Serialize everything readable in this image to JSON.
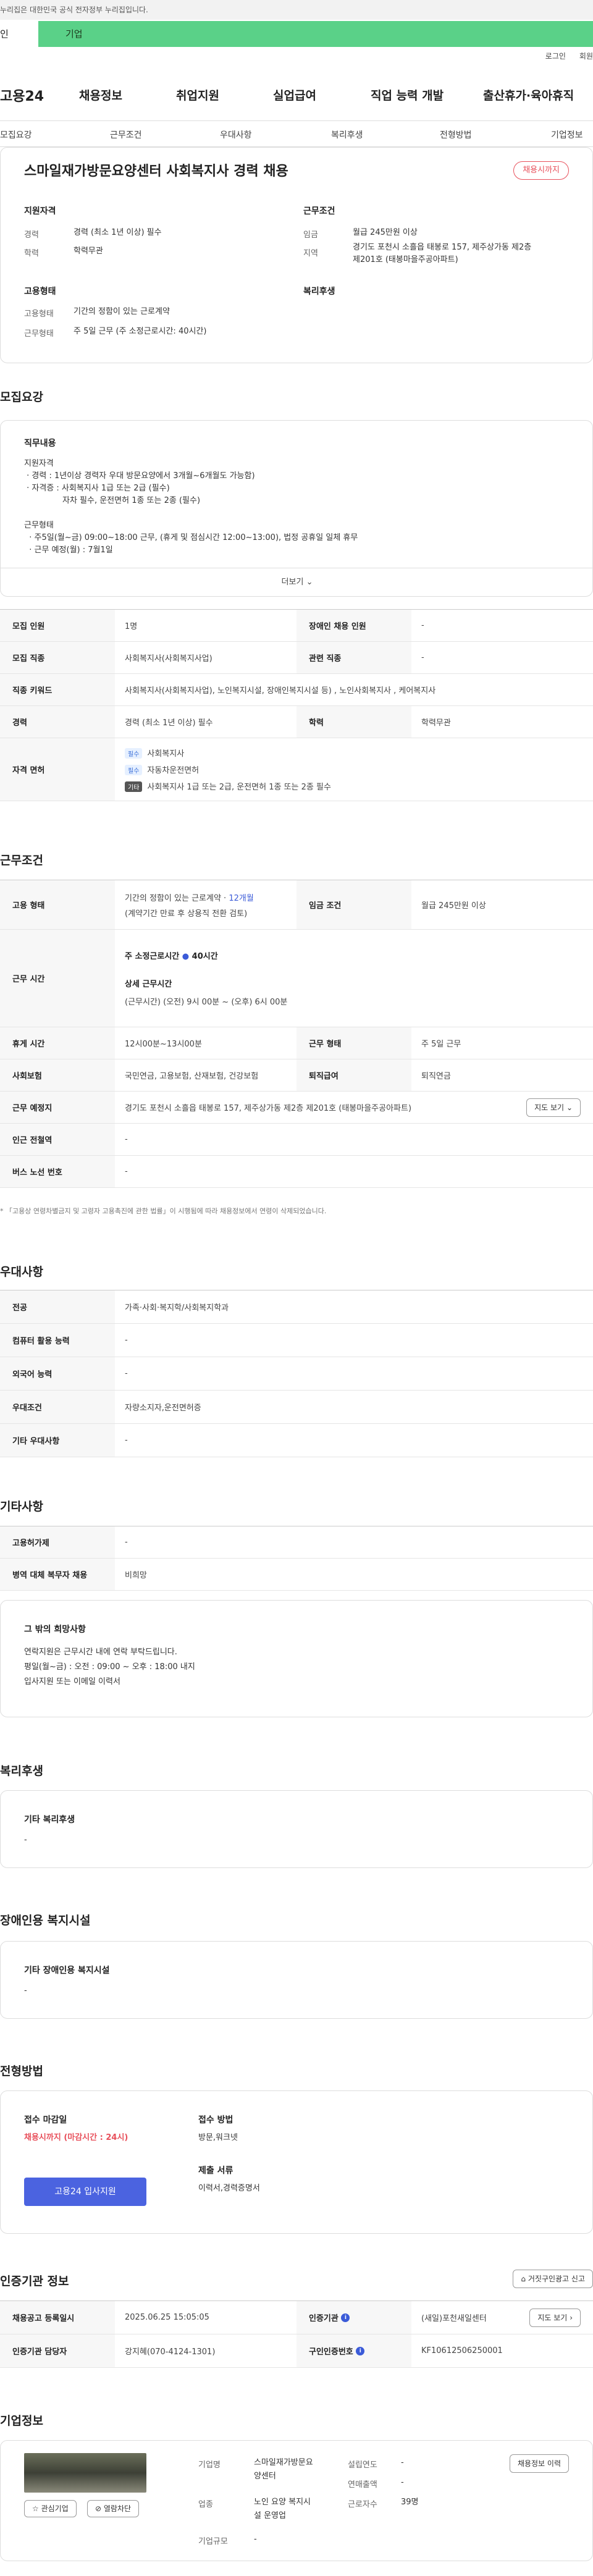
{
  "top_notice": "누리집은 대한민국 공식 전자정부 누리집입니다.",
  "tabs": {
    "person": "인",
    "company": "기업"
  },
  "util": {
    "login": "로그인",
    "join": "회원"
  },
  "logo": "고용24",
  "gnb": [
    "채용정보",
    "취업지원",
    "실업급여",
    "직업 능력 개발",
    "출산휴가·육아휴직"
  ],
  "subnav": [
    "모집요강",
    "근무조건",
    "우대사항",
    "복리후생",
    "전형방법",
    "기업정보"
  ],
  "job": {
    "title": "스마일재가방문요양센터 사회복지사 경력 채용",
    "status_badge": "채용시까지",
    "qual_label": "지원자격",
    "career_k": "경력",
    "career_v": "경력 (최소 1년 이상) 필수",
    "edu_k": "학력",
    "edu_v": "학력무관",
    "emp_label": "고용형태",
    "emptype_k": "고용형태",
    "emptype_v": "기간의 정함이 있는 근로계약",
    "worktype_k": "근무형태",
    "worktype_v": "주 5일 근무 (주 소정근로시간: 40시간)",
    "cond_label": "근무조건",
    "wage_k": "임금",
    "wage_v": "월급 245만원 이상",
    "area_k": "지역",
    "area_v1": "경기도 포천시 소흘읍 태봉로 157, 제주상가동 제2층",
    "area_v2": "제201호 (태봉마을주공아파트)",
    "welfare_label": "복리후생"
  },
  "recruit": {
    "heading": "모집요강",
    "duty_title": "직무내용",
    "duty_text": "지원자격\n · 경력 : 1년이상 경력자 우대 방문요양에서 3개월~6개월도 가능함)\n · 자격증 : 사회복지사 1급 또는 2급 (필수)\n               자차 필수, 운전면허 1종 또는 2종 (필수)\n\n근무형태\n  · 주5일(월~금) 09:00~18:00 근무, (휴게 및 점심시간 12:00~13:00), 법정 공휴일 일체 휴무\n  · 근무 예정(월) : 7월1일",
    "more": "더보기",
    "rows": [
      {
        "k1": "모집 인원",
        "v1": "1명",
        "k2": "장애인 채용 인원",
        "v2": "-"
      },
      {
        "k1": "모집 직종",
        "v1": "사회복지사(사회복지사업)",
        "k2": "관련 직종",
        "v2": "-"
      },
      {
        "k1": "직종 키워드",
        "v1": "사회복지사(사회복지사업), 노인복지시설, 장애인복지시설 등) , 노인사회복지사 , 케어복지사"
      },
      {
        "k1": "경력",
        "v1": "경력 (최소 1년 이상) 필수",
        "k2": "학력",
        "v2": "학력무관"
      }
    ],
    "license_k": "자격 면허",
    "licenses": [
      {
        "chip": "필수",
        "text": "사회복지사"
      },
      {
        "chip": "필수",
        "text": "자동차운전면허"
      },
      {
        "chip": "기타",
        "text": "사회복지사 1급 또는 2급, 운전면허 1종 또는 2종 필수"
      }
    ]
  },
  "work": {
    "heading": "근무조건",
    "emp_k": "고용 형태",
    "emp_v1": "기간의 정함이 있는 근로계약 · ",
    "emp_v1b": "12개월",
    "emp_v2": "(계약기간 만료 후 상용직 전환 검토)",
    "wage_k": "임금 조건",
    "wage_v": "월급 245만원 이상",
    "time_k": "근무 시간",
    "time_v1": "주 소정근로시간",
    "time_v1b": "40시간",
    "time_v2": "상세 근무시간",
    "time_v3": "(근무시간) (오전) 9시 00분 ~ (오후) 6시 00분",
    "break_k": "휴게 시간",
    "break_v": "12시00분~13시00분",
    "form_k": "근무 형태",
    "form_v": "주 5일 근무",
    "ins_k": "사회보험",
    "ins_v": "국민연금, 고용보험, 산재보험, 건강보험",
    "ret_k": "퇴직급여",
    "ret_v": "퇴직연금",
    "place_k": "근무 예정지",
    "place_v": "경기도 포천시 소흘읍 태봉로 157, 제주상가동 제2층 제201호 (태봉마을주공아파트)",
    "map_btn": "지도 보기",
    "subway_k": "인근 전철역",
    "subway_v": "-",
    "bus_k": "버스 노선 번호",
    "bus_v": "-",
    "note": "* 「고용상 연령차별금지 및 고령자 고용촉진에 관한 법률」이 시행됨에 따라 채용정보에서 연령이 삭제되었습니다."
  },
  "pref": {
    "heading": "우대사항",
    "rows": [
      {
        "k": "전공",
        "v": "가족·사회·복지학/사회복지학과"
      },
      {
        "k": "컴퓨터 활용 능력",
        "v": "-"
      },
      {
        "k": "외국어 능력",
        "v": "-"
      },
      {
        "k": "우대조건",
        "v": "자량소지자,운전면허증"
      },
      {
        "k": "기타 우대사항",
        "v": "-"
      }
    ]
  },
  "etc": {
    "heading": "기타사항",
    "rows": [
      {
        "k": "고용허가제",
        "v": "-"
      },
      {
        "k": "병역 대체 복무자 채용",
        "v": "비희망"
      }
    ],
    "box_title": "그 밖의 희망사항",
    "box_text": "연락지원은 근무시간 내에 연락 부탁드립니다.\n평일(월~금) : 오전 : 09:00 ~ 오후 : 18:00 내지\n입사지원 또는 이메일 이력서"
  },
  "welfare": {
    "heading": "복리후생",
    "title": "기타 복리후생",
    "value": "-"
  },
  "disab": {
    "heading": "장애인용 복지시설",
    "title": "기타 장애인용 복지시설",
    "value": "-"
  },
  "apply": {
    "heading": "전형방법",
    "deadline_k": "접수 마감일",
    "deadline_v": "채용시까지 (마감시간 : 24시)",
    "btn": "고용24 입사지원",
    "method_k": "접수 방법",
    "method_v": "방문,워크넷",
    "docs_k": "제출 서류",
    "docs_v": "이력서,경력증명서"
  },
  "cert": {
    "heading": "인증기관 정보",
    "report_btn": "거짓구인광고 신고",
    "reg_k": "채용공고 등록일시",
    "reg_v": "2025.06.25 15:05:05",
    "org_k": "인증기관",
    "org_v": "(새일)포천새일센터",
    "map_btn": "지도 보기",
    "mgr_k": "인증기관 담당자",
    "mgr_v": "강지혜(070-4124-1301)",
    "num_k": "구인인증번호",
    "num_v": "KF10612506250001"
  },
  "company": {
    "heading": "기업정보",
    "fav_btn": "관심기업",
    "block_btn": "열람차단",
    "name_k": "기업명",
    "name_v1": "스마일재가방문요",
    "name_v2": "양센터",
    "ind_k": "업종",
    "ind_v1": "노인 요양 복지시",
    "ind_v2": "설 운영업",
    "year_k": "설립연도",
    "year_v": "-",
    "sales_k": "연매출액",
    "sales_v": "-",
    "staff_k": "근로자수",
    "staff_v": "39명",
    "type_k": "기업규모",
    "type_v": "-",
    "jobs_btn": "채용정보 이력"
  }
}
